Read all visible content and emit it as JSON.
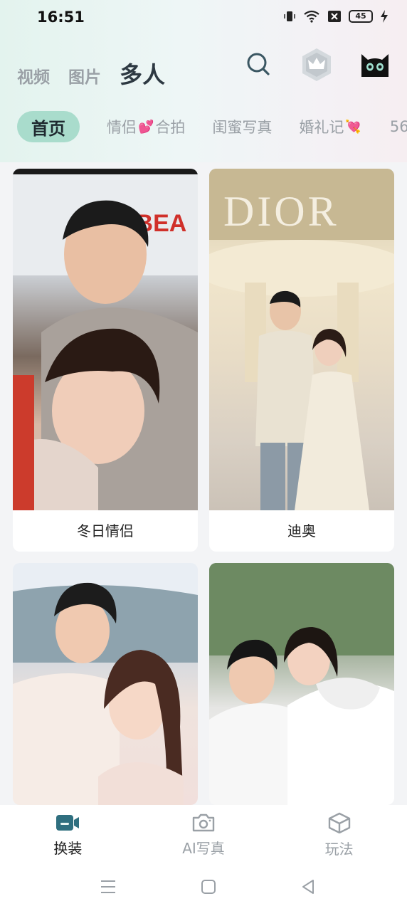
{
  "status": {
    "time": "16:51",
    "battery": "45"
  },
  "header": {
    "tabs": [
      {
        "label": "视频",
        "active": false
      },
      {
        "label": "图片",
        "active": false
      },
      {
        "label": "多人",
        "active": true
      }
    ],
    "icons": [
      "search-icon",
      "crown-badge-icon",
      "cat-avatar-icon"
    ]
  },
  "categories": {
    "home": "首页",
    "couple_a": "情侣",
    "couple_b": "合拍",
    "bestie": "闺蜜写真",
    "wedding": "婚礼记",
    "more": "56"
  },
  "cards": [
    {
      "caption": "冬日情侣"
    },
    {
      "caption": "迪奥"
    },
    {
      "caption": ""
    },
    {
      "caption": ""
    }
  ],
  "photo_text": {
    "sign": "&BEA",
    "brand": "DIOR"
  },
  "bottom_nav": [
    {
      "label": "换装",
      "icon": "camera-icon",
      "active": true
    },
    {
      "label": "AI写真",
      "icon": "photo-camera-icon",
      "active": false
    },
    {
      "label": "玩法",
      "icon": "cube-icon",
      "active": false
    }
  ],
  "colors": {
    "accent": "#a9dccc",
    "nav_active_icon": "#2f6f7f"
  }
}
